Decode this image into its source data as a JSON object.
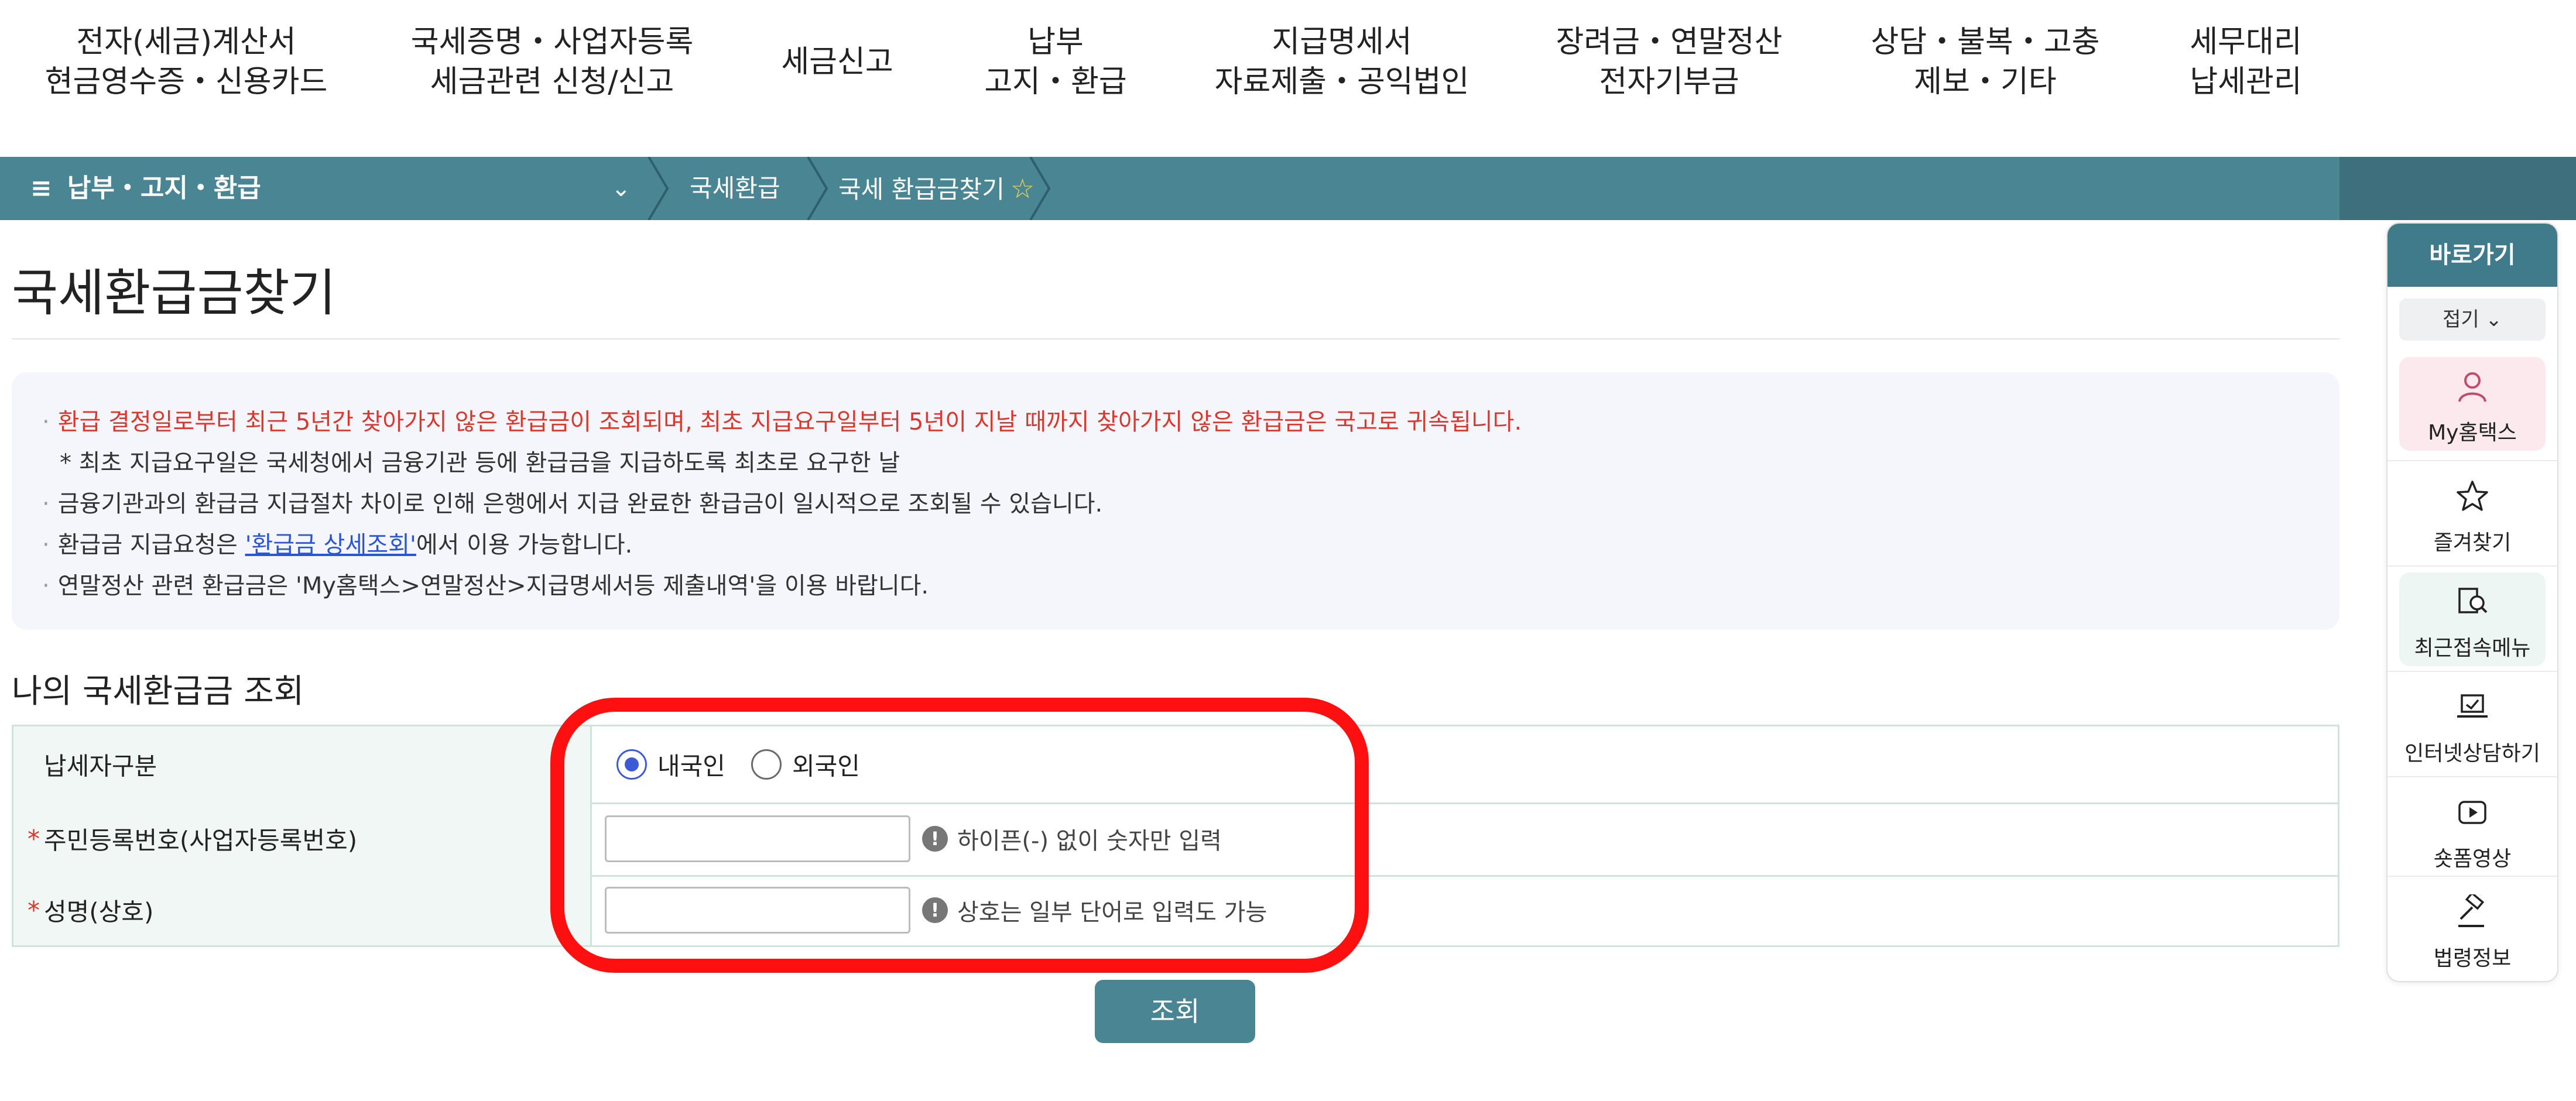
{
  "topnav": {
    "items": [
      {
        "line1": "전자(세금)계산서",
        "line2": "현금영수증・신용카드"
      },
      {
        "line1": "국세증명・사업자등록",
        "line2": "세금관련 신청/신고"
      },
      {
        "line1": "세금신고",
        "line2": ""
      },
      {
        "line1": "납부",
        "line2": "고지・환급"
      },
      {
        "line1": "지급명세서",
        "line2": "자료제출・공익법인"
      },
      {
        "line1": "장려금・연말정산",
        "line2": "전자기부금"
      },
      {
        "line1": "상담・불복・고충",
        "line2": "제보・기타"
      },
      {
        "line1": "세무대리",
        "line2": "납세관리"
      }
    ]
  },
  "breadcrumb": {
    "menu_icon": "≡",
    "menu_label": "납부・고지・환급",
    "chevron": "⌄",
    "items": [
      "국세환급",
      "국세 환급금찾기"
    ],
    "fav_icon": "☆"
  },
  "page": {
    "title": "국세환급금찾기",
    "notice": {
      "line1": "환급 결정일로부터 최근 5년간 찾아가지 않은 환급금이 조회되며, 최초 지급요구일부터 5년이 지날 때까지 찾아가지 않은 환급금은 국고로 귀속됩니다.",
      "line2": "* 최초 지급요구일은 국세청에서 금융기관 등에 환급금을 지급하도록 최초로 요구한 날",
      "line3": "금융기관과의 환급금 지급절차 차이로 인해 은행에서 지급 완료한 환급금이 일시적으로 조회될 수 있습니다.",
      "line4_pre": "환급금 지급요청은 ",
      "line4_link": "'환급금 상세조회'",
      "line4_post": "에서 이용 가능합니다.",
      "line5": "연말정산 관련 환급금은 'My홈택스>연말정산>지급명세서등 제출내역'을 이용 바랍니다."
    },
    "section_title": "나의 국세환급금 조회"
  },
  "form": {
    "row1_label": "납세자구분",
    "radio_domestic": "내국인",
    "radio_foreign": "외국인",
    "selected": "내국인",
    "row2_label": "주민등록번호(사업자등록번호)",
    "row2_value": "",
    "row2_hint": "하이픈(-) 없이 숫자만 입력",
    "row3_label": "성명(상호)",
    "row3_value": "",
    "row3_hint": "상호는 일부 단어로 입력도 가능",
    "required_mark": "*",
    "hint_icon": "!",
    "submit_label": "조회"
  },
  "quick": {
    "title": "바로가기",
    "fold_label": "접기 ⌄",
    "items": [
      {
        "label": "My홈택스",
        "icon": "person-icon"
      },
      {
        "label": "즐겨찾기",
        "icon": "star-icon"
      },
      {
        "label": "최근접속메뉴",
        "icon": "recent-menu-icon"
      },
      {
        "label": "인터넷상담하기",
        "icon": "laptop-chat-icon"
      },
      {
        "label": "숏폼영상",
        "icon": "play-icon"
      },
      {
        "label": "법령정보",
        "icon": "gavel-icon"
      }
    ]
  },
  "colors": {
    "accent": "#4a8594",
    "notice_red": "#d9382f",
    "highlight": "#ff1010"
  }
}
